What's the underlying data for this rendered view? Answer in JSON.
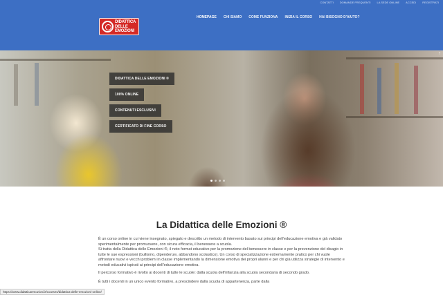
{
  "topbar": {
    "links": [
      "Contatti",
      "Domande frequenti",
      "La sede online",
      "Accedi",
      "Registrati"
    ]
  },
  "logo": {
    "lines": [
      "DIDATTICA",
      "DELLE",
      "EMOZIONI"
    ]
  },
  "nav": {
    "items": [
      "Homepage",
      "Chi siamo",
      "Come funziona",
      "Inizia il corso",
      "Hai bisogno d'aiuto?"
    ]
  },
  "hero": {
    "tags": [
      "Didattica delle Emozioni ®",
      "100% online",
      "Contenuti esclusivi",
      "Certificato di fine corso"
    ],
    "slides_total": 4,
    "active_slide": 1
  },
  "content": {
    "title": "La Didattica delle Emozioni ®",
    "p1": "È un corso online in cui viene insegnato, spiegato e descritto un metodo di intervento basato sui principi dell'educazione emotiva e già validato sperimentalmente per promuovere, con sicura efficacia, il benessere a scuola.",
    "p2": "Si tratta della Didattica delle Emozioni ®, il noto format educativo per la promozione del benessere in classe e per la prevenzione del disagio in tutte le sue espressioni (bullismo, dipendenze, abbandono scolastico). Un corso di specializzazione estremamente pratico per chi vuole affrontare nuovi e vecchi problemi in classe implementando la dimensione emotiva dei propri alunni e per chi già utilizza strategie di intervento e metodi educativi ispirati ai principi dell'educazione emotiva.",
    "p3": "Il percorso formativo è rivolto ai docenti di tutte le scuole: dalla scuola dell'infanzia alla scuola secondaria di secondo grado.",
    "p4": "È tutti i docenti in un unico evento formativo, a prescindere dalla scuola di appartenenza, parte dalla"
  },
  "statusbar": {
    "url": "https://www.didatticaemozioni.it/courses/didattica-delle-emozioni-online/"
  }
}
